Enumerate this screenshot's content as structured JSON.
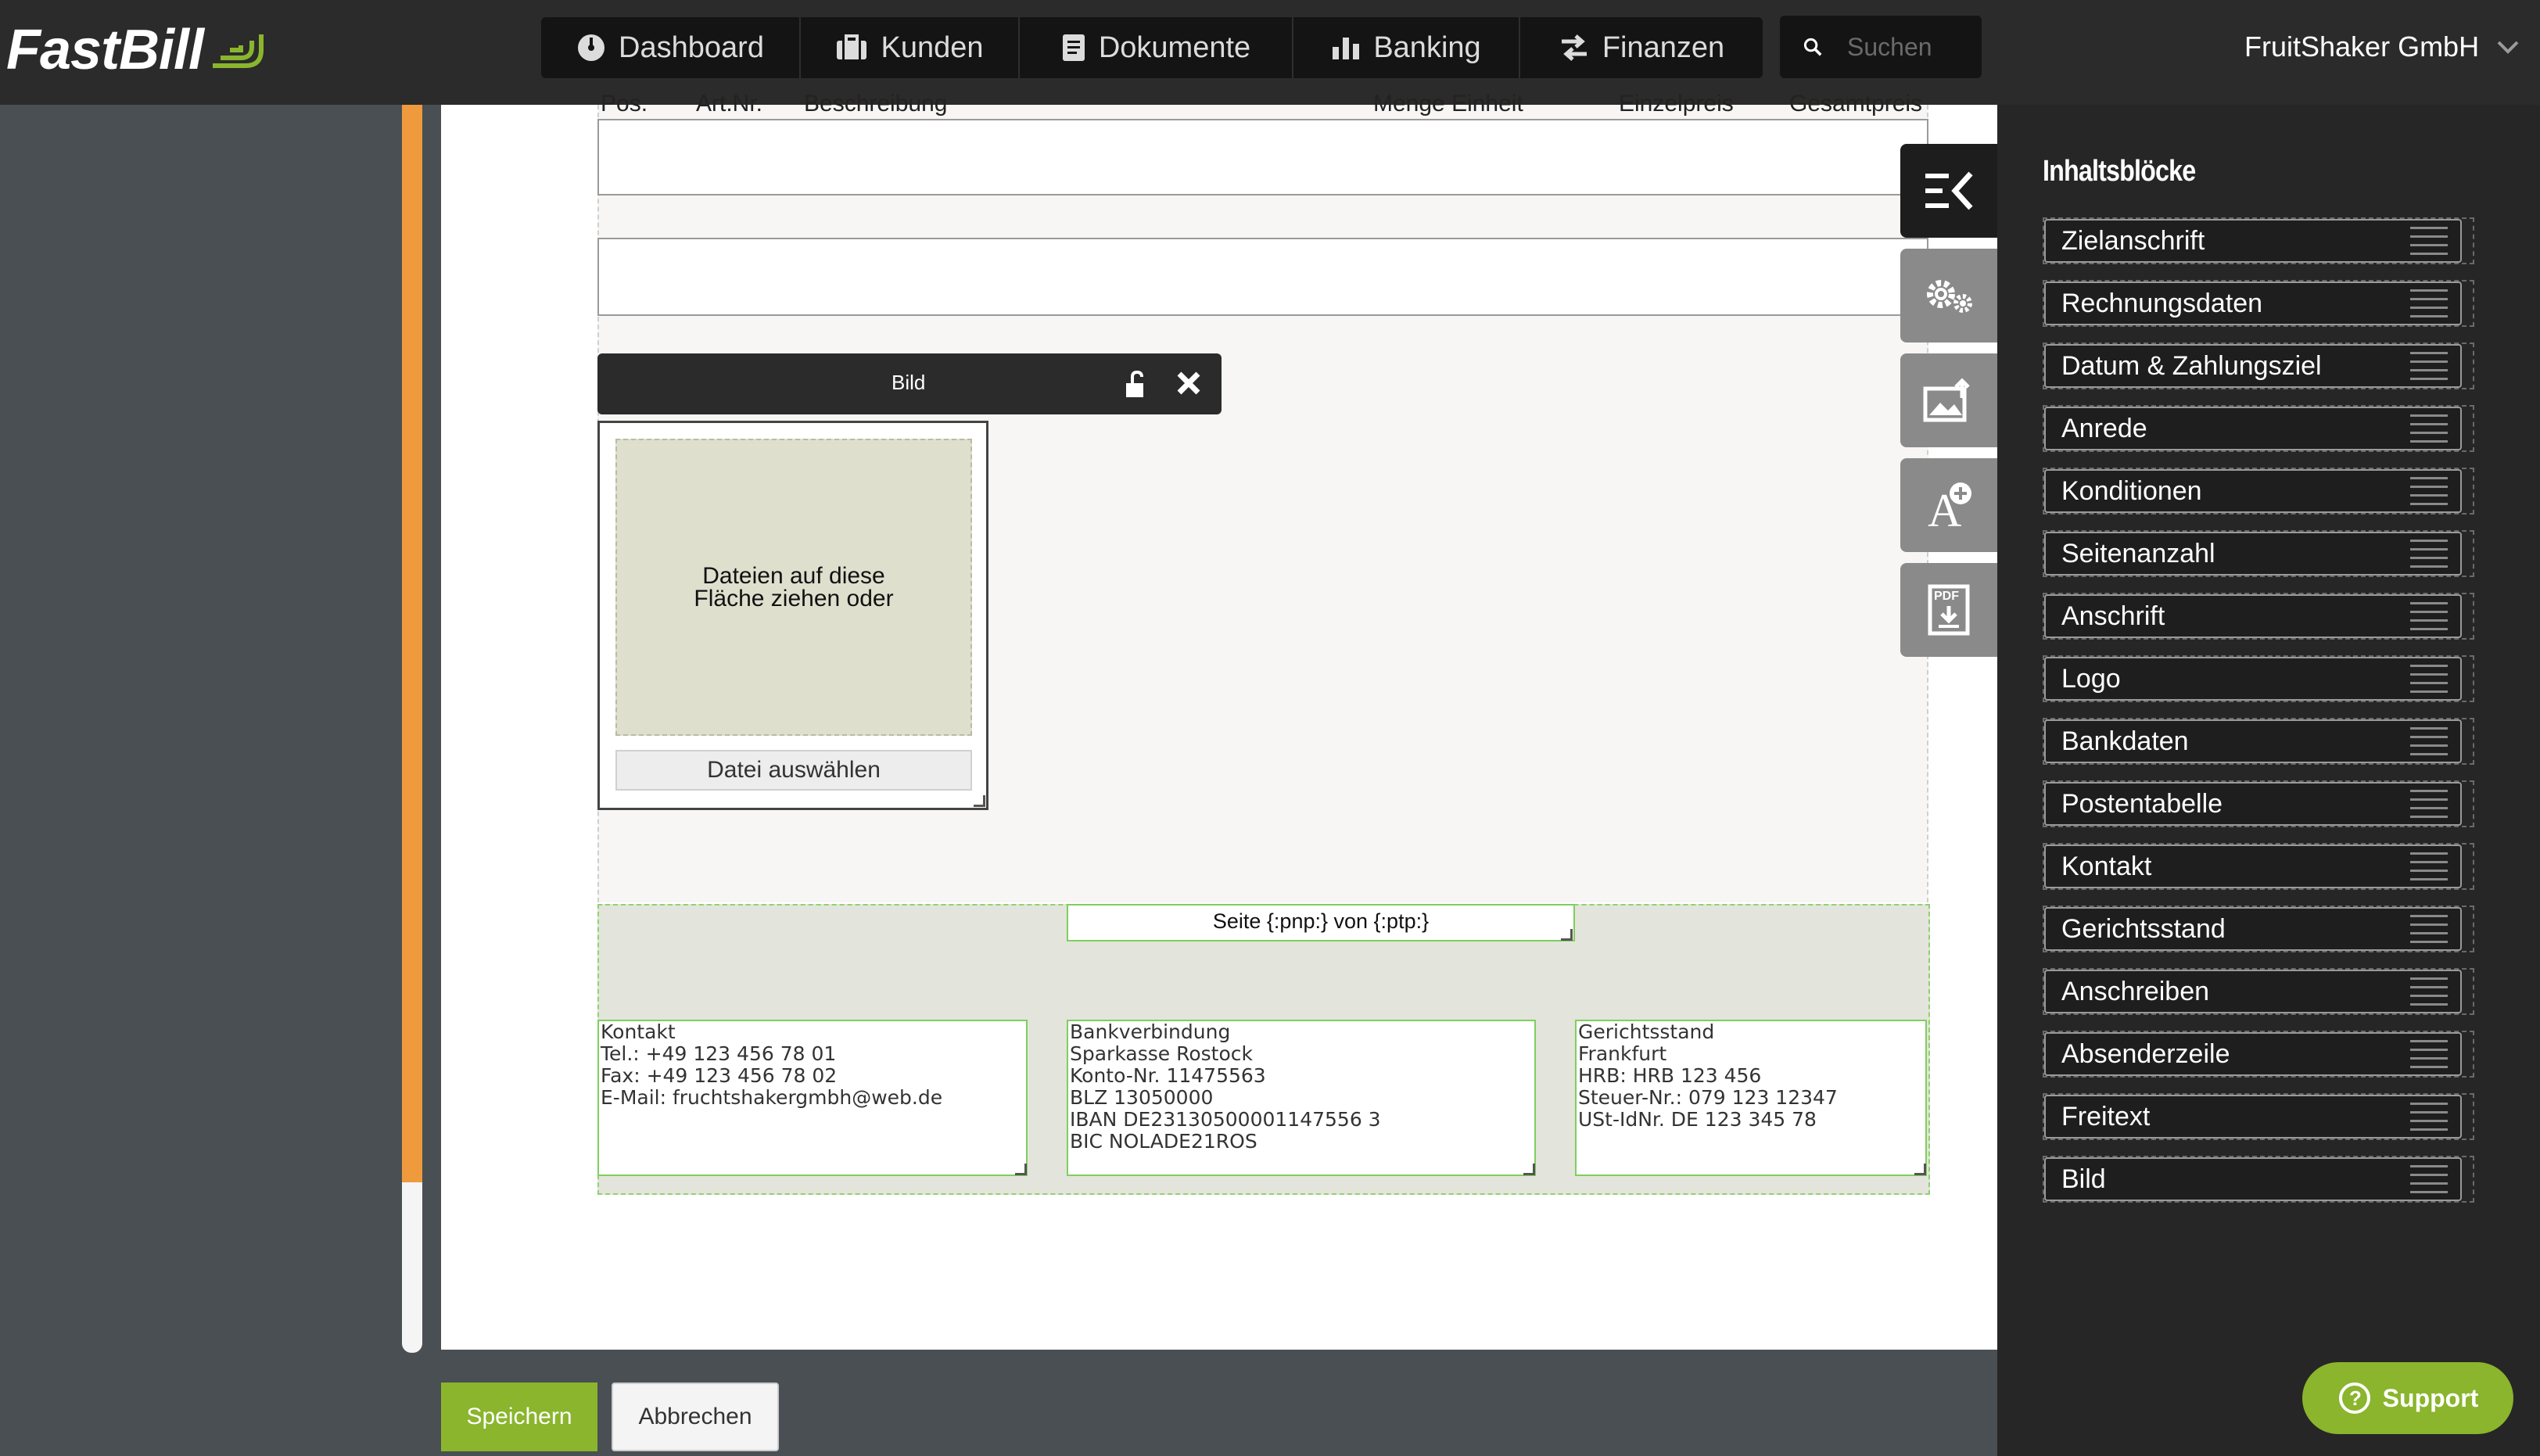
{
  "brand": {
    "logo_text": "FastBill"
  },
  "nav": {
    "items": [
      {
        "label": "Dashboard",
        "icon": "dashboard-icon"
      },
      {
        "label": "Kunden",
        "icon": "briefcase-icon"
      },
      {
        "label": "Dokumente",
        "icon": "document-icon"
      },
      {
        "label": "Banking",
        "icon": "bar-chart-icon"
      },
      {
        "label": "Finanzen",
        "icon": "transfer-arrows-icon"
      }
    ]
  },
  "search": {
    "placeholder": "Suchen"
  },
  "account": {
    "company": "FruitShaker GmbH"
  },
  "table_header": {
    "pos": "Pos.",
    "artnr": "Art.Nr.",
    "beschreibung": "Beschreibung",
    "menge": "Menge Einheit",
    "einzelpreis": "Einzelpreis",
    "gesamtpreis": "Gesamtpreis"
  },
  "bild_block": {
    "title": "Bild",
    "drop_text": "Dateien auf diese Fläche ziehen oder",
    "file_button": "Datei auswählen"
  },
  "footer": {
    "page_number": "Seite {:pnp:} von {:ptp:}",
    "kontakt": [
      "Kontakt",
      "Tel.: +49 123 456 78 01",
      "Fax: +49 123 456 78 02",
      "E-Mail: fruchtshakergmbh@web.de"
    ],
    "bank": [
      "Bankverbindung",
      "Sparkasse Rostock",
      "Konto-Nr. 11475563",
      "BLZ 13050000",
      "IBAN DE23130500001147556 3",
      "BIC NOLADE21ROS"
    ],
    "gericht": [
      "Gerichtsstand",
      "Frankfurt",
      "HRB: HRB 123 456",
      "Steuer-Nr.: 079 123 12347",
      "USt-IdNr. DE 123 345 78"
    ]
  },
  "actions": {
    "save": "Speichern",
    "cancel": "Abbrechen"
  },
  "panel": {
    "title": "Inhaltsblöcke",
    "blocks": [
      "Zielanschrift",
      "Rechnungsdaten",
      "Datum & Zahlungsziel",
      "Anrede",
      "Konditionen",
      "Seitenanzahl",
      "Anschrift",
      "Logo",
      "Bankdaten",
      "Postentabelle",
      "Kontakt",
      "Gerichtsstand",
      "Anschreiben",
      "Absenderzeile",
      "Freitext",
      "Bild"
    ]
  },
  "support": {
    "label": "Support"
  },
  "colors": {
    "accent_green": "#8ab52d",
    "rail_orange": "#ef9a3d",
    "topbar": "#2b2b2b"
  }
}
